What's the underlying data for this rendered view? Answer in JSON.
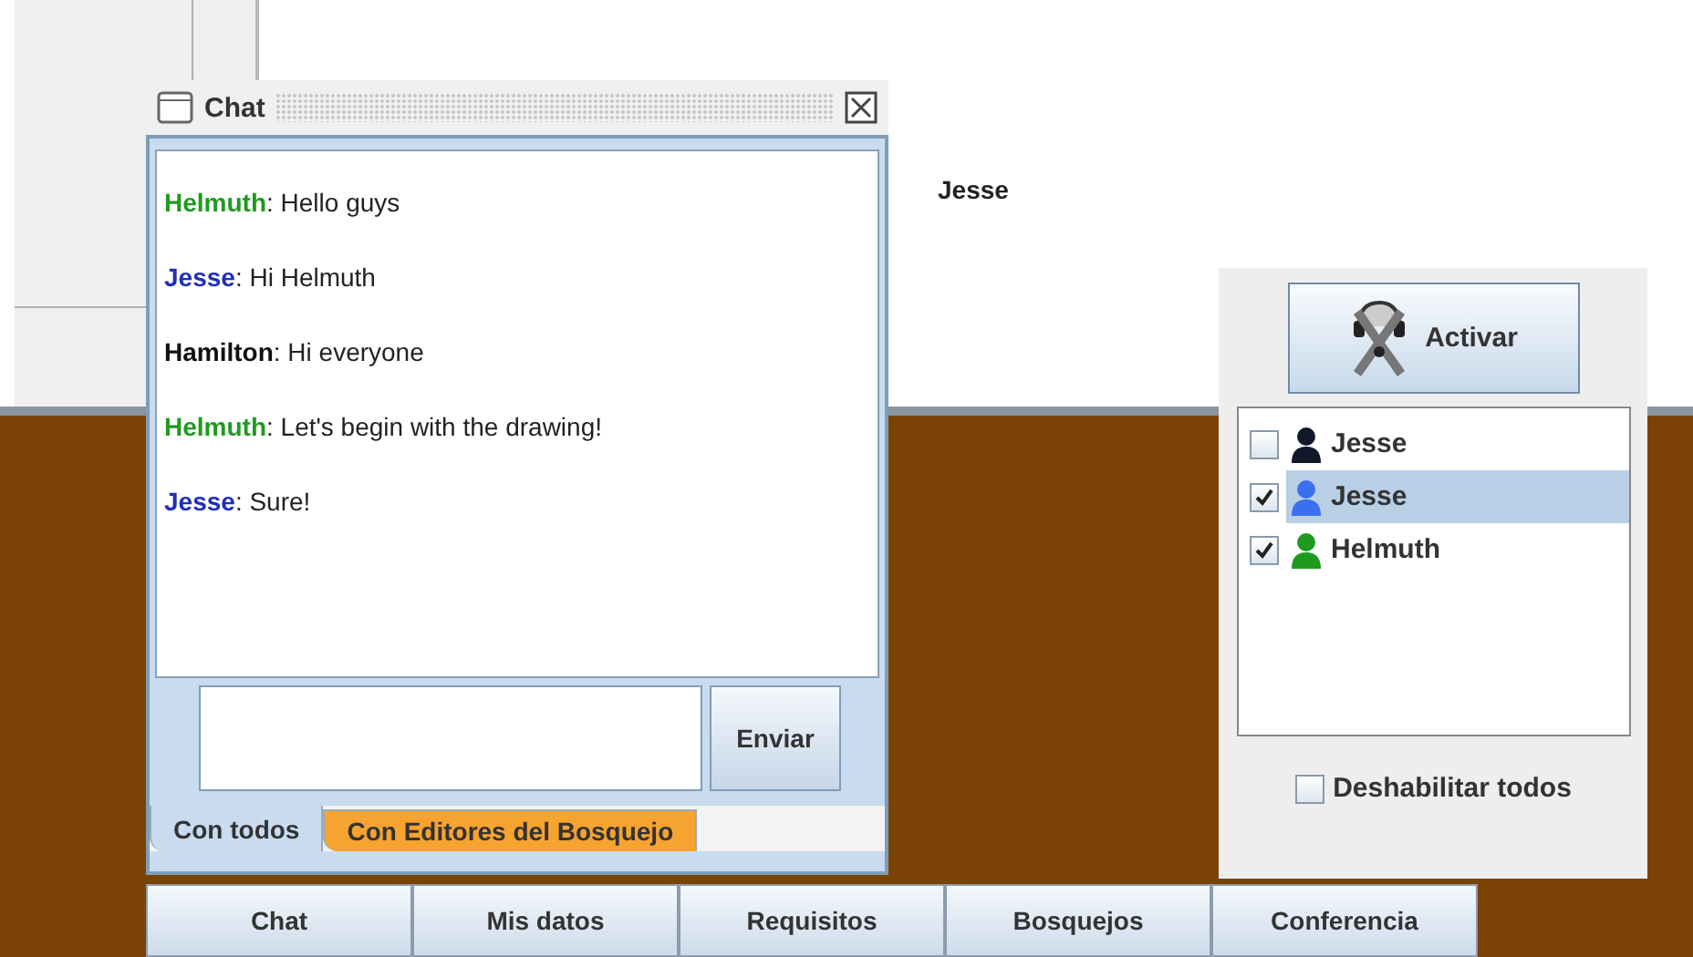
{
  "canvas": {
    "user_label": "Jesse"
  },
  "chat_window": {
    "title": "Chat",
    "messages": [
      {
        "author": "Helmuth",
        "color": "#1f9a1f",
        "text": ": Hello guys"
      },
      {
        "author": "Jesse",
        "color": "#1f2fb8",
        "text": ": Hi Helmuth"
      },
      {
        "author": "Hamilton",
        "color": "#111111",
        "text": ": Hi everyone"
      },
      {
        "author": "Helmuth",
        "color": "#1f9a1f",
        "text": ": Let's begin with the drawing!"
      },
      {
        "author": "Jesse",
        "color": "#1f2fb8",
        "text": ": Sure!"
      }
    ],
    "send_button": "Enviar",
    "tabs": [
      {
        "label": "Con todos",
        "selected": true,
        "alert": false
      },
      {
        "label": "Con Editores del Bosquejo",
        "selected": false,
        "alert": true
      }
    ]
  },
  "conference_panel": {
    "activate_button": "Activar",
    "participants": [
      {
        "name": "Jesse",
        "checked": false,
        "selected": false,
        "color": "#10182a"
      },
      {
        "name": "Jesse",
        "checked": true,
        "selected": true,
        "color": "#3a6ff0"
      },
      {
        "name": "Helmuth",
        "checked": true,
        "selected": false,
        "color": "#1f9a1f"
      }
    ],
    "disable_all": {
      "label": "Deshabilitar todos",
      "checked": false
    }
  },
  "nav_tabs": [
    "Chat",
    "Mis datos",
    "Requisitos",
    "Bosquejos",
    "Conferencia"
  ]
}
